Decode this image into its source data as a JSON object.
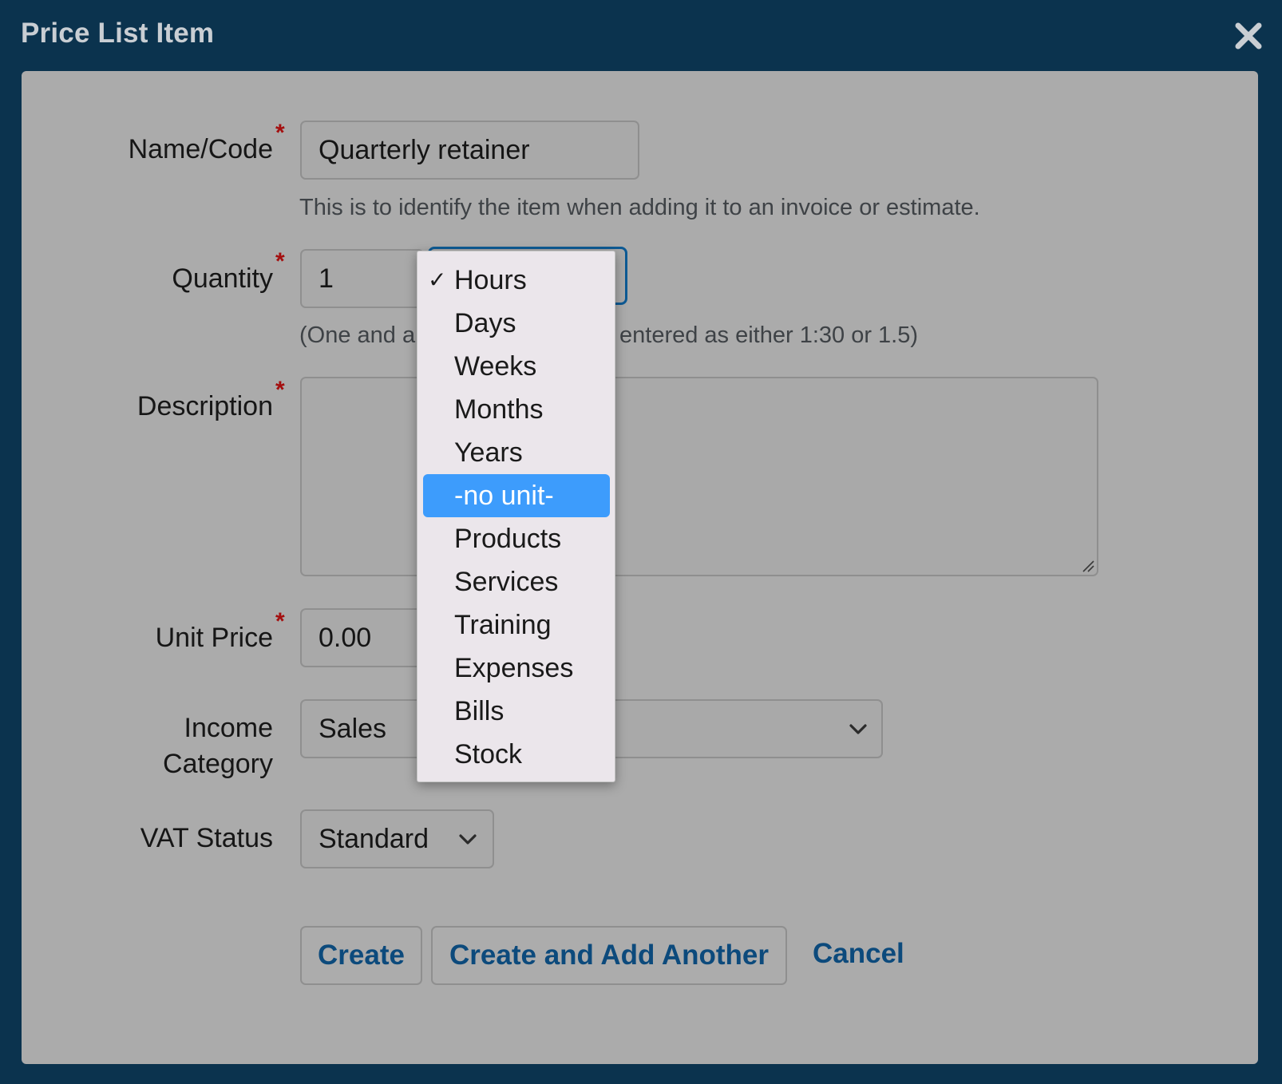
{
  "dialog": {
    "title": "Price List Item",
    "close_icon": "close-icon"
  },
  "form": {
    "name": {
      "label": "Name/Code",
      "required_mark": "*",
      "value": "Quarterly retainer",
      "hint": "This is to identify the item when adding it to an invoice or estimate."
    },
    "quantity": {
      "label": "Quantity",
      "required_mark": "*",
      "value": "1",
      "hint_left": "(One and a",
      "hint_right": "entered as either 1:30 or 1.5)"
    },
    "description": {
      "label": "Description",
      "required_mark": "*",
      "value": ""
    },
    "unit_price": {
      "label": "Unit Price",
      "required_mark": "*",
      "value": "0.00"
    },
    "income_category": {
      "label_line1": "Income",
      "label_line2": "Category",
      "value": "Sales"
    },
    "vat_status": {
      "label": "VAT Status",
      "value": "Standard"
    }
  },
  "unit_dropdown": {
    "checked_mark": "✓",
    "selected": "Hours",
    "highlighted": "-no unit-",
    "options": [
      "Hours",
      "Days",
      "Weeks",
      "Months",
      "Years",
      "-no unit-",
      "Products",
      "Services",
      "Training",
      "Expenses",
      "Bills",
      "Stock"
    ]
  },
  "actions": {
    "create": "Create",
    "create_another": "Create and Add Another",
    "cancel": "Cancel"
  },
  "colors": {
    "header_bg": "#0b334e",
    "panel_bg": "#ababab",
    "link": "#0c4a7c",
    "highlight": "#3d9cfc",
    "required": "#a40e0e"
  }
}
